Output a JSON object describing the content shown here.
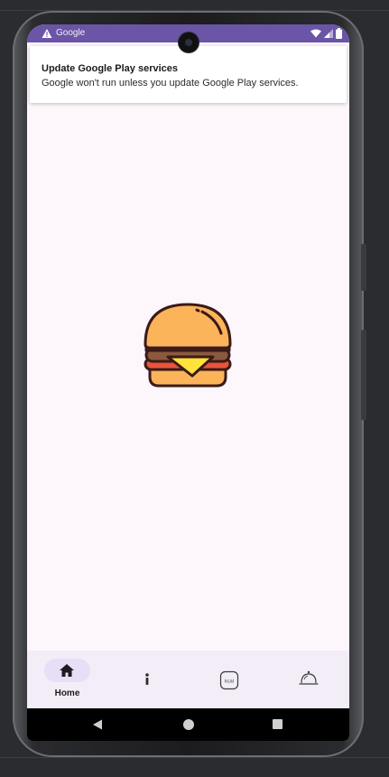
{
  "status_bar": {
    "app_name": "Google",
    "bar_color": "#6a55a6",
    "warning_icon": "warning-triangle-icon",
    "icons": [
      "wifi-icon",
      "signal-icon",
      "battery-icon"
    ]
  },
  "notification": {
    "title": "Update Google Play services",
    "body": "Google won't run unless you update Google Play services."
  },
  "main": {
    "image": "hamburger-illustration"
  },
  "bottom_nav": {
    "items": [
      {
        "id": "home",
        "label": "Home",
        "icon": "home-icon",
        "selected": true
      },
      {
        "id": "info",
        "label": "",
        "icon": "info-icon",
        "selected": false
      },
      {
        "id": "kcal",
        "label": "",
        "icon": "kcal-icon",
        "selected": false
      },
      {
        "id": "dish",
        "label": "",
        "icon": "cloche-icon",
        "selected": false
      }
    ],
    "kcal_icon_text": "kcal",
    "accent": "#e8def8",
    "background": "#f2edf6"
  },
  "system_nav": {
    "buttons": [
      "back-icon",
      "home-circle-icon",
      "recents-icon"
    ]
  },
  "colors": {
    "screen_background": "#fdf7fc",
    "emulator_background": "#2b2c30"
  }
}
